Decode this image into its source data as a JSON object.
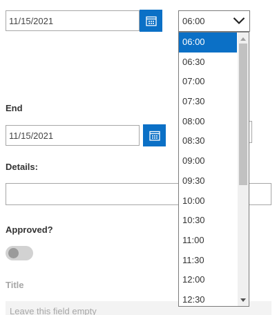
{
  "start": {
    "date_value": "11/15/2021",
    "time_selected": "06:00"
  },
  "end": {
    "label": "End",
    "date_value": "11/15/2021"
  },
  "details": {
    "label": "Details:"
  },
  "approved": {
    "label": "Approved?",
    "toggle_on": false
  },
  "title_field": {
    "label": "Title",
    "placeholder": "Leave this field empty"
  },
  "time_options": [
    "06:00",
    "06:30",
    "07:00",
    "07:30",
    "08:00",
    "08:30",
    "09:00",
    "09:30",
    "10:00",
    "10:30",
    "11:00",
    "11:30",
    "12:00",
    "12:30"
  ],
  "colors": {
    "accent": "#0b70c6",
    "border": "#a6a6a6",
    "muted_text": "#a6a6a6"
  },
  "icons": {
    "calendar": "calendar-icon",
    "chevron": "chevron-down-icon"
  }
}
